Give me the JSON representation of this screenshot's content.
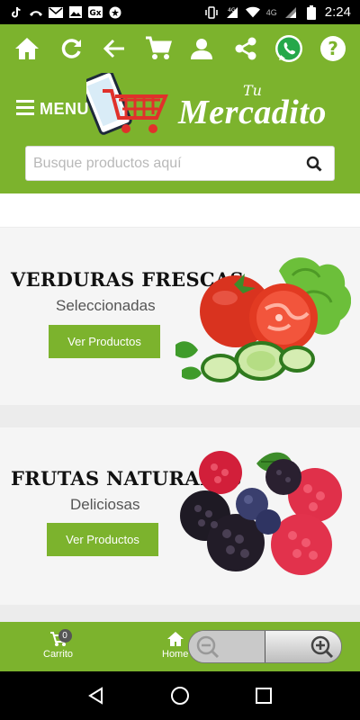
{
  "status_bar": {
    "time": "2:24",
    "network_label": "4G",
    "icons": [
      "tiktok-icon",
      "missed-call-icon",
      "gmail-icon",
      "image-icon",
      "reddit-icon",
      "app-icon",
      "vibrate-icon",
      "lte-icon",
      "wifi-icon",
      "signal-icon",
      "battery-icon"
    ]
  },
  "header": {
    "icons": [
      "home-icon",
      "refresh-icon",
      "back-arrow-icon",
      "cart-icon",
      "user-icon",
      "share-icon",
      "whatsapp-icon",
      "help-icon"
    ],
    "menu_label": "MENU",
    "logo": {
      "tu": "Tu",
      "brand": "Mercadito"
    },
    "search": {
      "placeholder": "Busque productos aquí",
      "value": ""
    }
  },
  "banners": [
    {
      "title": "VERDURAS FRESCAS",
      "subtitle": "Seleccionadas",
      "button": "Ver Productos",
      "image": "vegetables-image"
    },
    {
      "title": "FRUTAS NATURALES",
      "subtitle": "Deliciosas",
      "button": "Ver Productos",
      "image": "berries-image"
    }
  ],
  "bottom_nav": {
    "cart_label": "Carrito",
    "cart_count": "0",
    "home_label": "Home"
  },
  "colors": {
    "accent": "#7cb32d",
    "cart_red": "#e0312b"
  }
}
